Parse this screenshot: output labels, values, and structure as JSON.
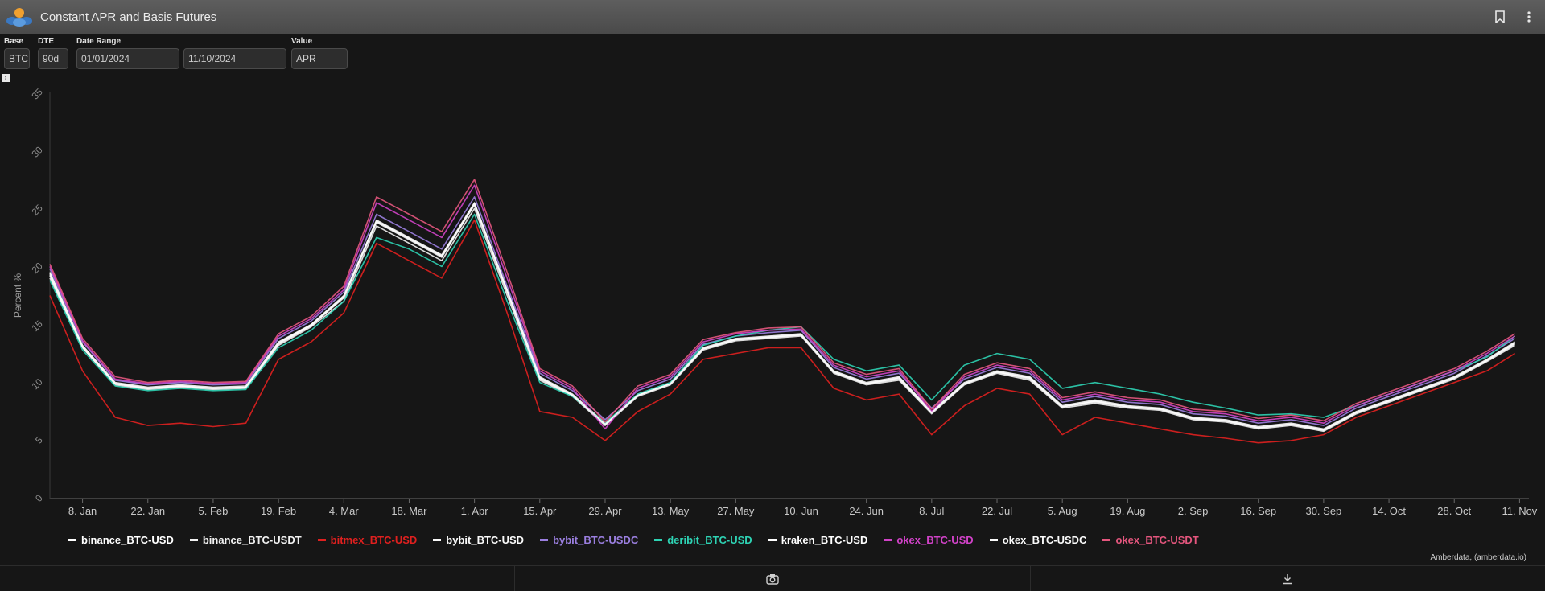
{
  "header": {
    "title": "Constant APR and Basis Futures"
  },
  "icons": {
    "logo": "amberdata-logo-icon",
    "bookmark": "bookmark-icon",
    "menu": "more-vertical-icon",
    "camera": "camera-icon",
    "download": "download-icon"
  },
  "controls": {
    "base": {
      "label": "Base",
      "value": "BTC"
    },
    "dte": {
      "label": "DTE",
      "value": "90d"
    },
    "date_range": {
      "label": "Date Range",
      "start": "01/01/2024",
      "end": "11/10/2024"
    },
    "value": {
      "label": "Value",
      "value": "APR"
    }
  },
  "credit": "Amberdata, (amberdata.io)",
  "chart_data": {
    "type": "line",
    "title": "",
    "xlabel": "",
    "ylabel": "Percent %",
    "ylim": [
      0,
      35
    ],
    "yticks": [
      0,
      5,
      10,
      15,
      20,
      25,
      30,
      35
    ],
    "x_ticks": [
      "8. Jan",
      "22. Jan",
      "5. Feb",
      "19. Feb",
      "4. Mar",
      "18. Mar",
      "1. Apr",
      "15. Apr",
      "29. Apr",
      "13. May",
      "27. May",
      "10. Jun",
      "24. Jun",
      "8. Jul",
      "22. Jul",
      "5. Aug",
      "19. Aug",
      "2. Sep",
      "16. Sep",
      "30. Sep",
      "14. Oct",
      "28. Oct",
      "11. Nov"
    ],
    "x": [
      "2024-01-01",
      "2024-01-08",
      "2024-01-15",
      "2024-01-22",
      "2024-01-29",
      "2024-02-05",
      "2024-02-12",
      "2024-02-19",
      "2024-02-26",
      "2024-03-04",
      "2024-03-11",
      "2024-03-18",
      "2024-03-25",
      "2024-04-01",
      "2024-04-08",
      "2024-04-15",
      "2024-04-22",
      "2024-04-29",
      "2024-05-06",
      "2024-05-13",
      "2024-05-20",
      "2024-05-27",
      "2024-06-03",
      "2024-06-10",
      "2024-06-17",
      "2024-06-24",
      "2024-07-01",
      "2024-07-08",
      "2024-07-15",
      "2024-07-22",
      "2024-07-29",
      "2024-08-05",
      "2024-08-12",
      "2024-08-19",
      "2024-08-26",
      "2024-09-02",
      "2024-09-09",
      "2024-09-16",
      "2024-09-23",
      "2024-09-30",
      "2024-10-07",
      "2024-10-14",
      "2024-10-21",
      "2024-10-28",
      "2024-11-04",
      "2024-11-10"
    ],
    "grid": false,
    "legend_position": "bottom",
    "series": [
      {
        "name": "binance_BTC-USD",
        "color": "#ffffff",
        "values": [
          19.5,
          13.2,
          10.0,
          9.6,
          9.8,
          9.6,
          9.7,
          13.5,
          15.0,
          17.5,
          24.0,
          22.5,
          21.0,
          25.5,
          18.0,
          10.5,
          9.0,
          6.5,
          9.0,
          10.0,
          13.0,
          13.8,
          14.0,
          14.2,
          11.0,
          10.0,
          10.5,
          7.5,
          10.0,
          11.0,
          10.5,
          8.0,
          8.5,
          8.0,
          7.8,
          7.0,
          6.8,
          6.2,
          6.5,
          6.0,
          7.5,
          8.5,
          9.5,
          10.5,
          12.0,
          13.5
        ]
      },
      {
        "name": "binance_BTC-USDT",
        "color": "#f2f2f2",
        "values": [
          19.0,
          13.0,
          9.8,
          9.4,
          9.6,
          9.4,
          9.5,
          13.2,
          14.8,
          17.0,
          23.5,
          22.0,
          20.5,
          25.0,
          17.5,
          10.2,
          8.8,
          6.3,
          8.8,
          9.8,
          12.8,
          13.6,
          13.8,
          14.0,
          10.8,
          9.8,
          10.2,
          7.3,
          9.8,
          10.8,
          10.2,
          7.8,
          8.2,
          7.8,
          7.6,
          6.8,
          6.6,
          6.0,
          6.3,
          5.8,
          7.3,
          8.3,
          9.3,
          10.3,
          11.8,
          13.2
        ]
      },
      {
        "name": "bitmex_BTC-USD",
        "color": "#e0201f",
        "values": [
          17.5,
          11.0,
          7.0,
          6.3,
          6.5,
          6.2,
          6.5,
          12.0,
          13.5,
          16.0,
          22.0,
          20.5,
          19.0,
          24.0,
          16.0,
          7.5,
          7.0,
          5.0,
          7.5,
          9.0,
          12.0,
          12.5,
          13.0,
          13.0,
          9.5,
          8.5,
          9.0,
          5.5,
          8.0,
          9.5,
          9.0,
          5.5,
          7.0,
          6.5,
          6.0,
          5.5,
          5.2,
          4.8,
          5.0,
          5.5,
          7.0,
          8.0,
          9.0,
          10.0,
          11.0,
          12.5
        ]
      },
      {
        "name": "bybit_BTC-USD",
        "color": "#fafafa",
        "values": [
          19.2,
          13.0,
          9.9,
          9.5,
          9.7,
          9.5,
          9.6,
          13.3,
          14.9,
          17.3,
          23.8,
          22.3,
          20.8,
          25.3,
          17.8,
          10.3,
          8.9,
          6.4,
          8.9,
          9.9,
          12.9,
          13.7,
          13.9,
          14.1,
          10.9,
          9.9,
          10.3,
          7.4,
          9.9,
          10.9,
          10.3,
          7.9,
          8.3,
          7.9,
          7.7,
          6.9,
          6.7,
          6.1,
          6.4,
          5.9,
          7.4,
          8.4,
          9.4,
          10.4,
          11.9,
          13.3
        ]
      },
      {
        "name": "bybit_BTC-USDC",
        "color": "#9b7fe0",
        "values": [
          19.8,
          13.5,
          10.2,
          9.8,
          10.0,
          9.8,
          9.9,
          13.8,
          15.3,
          17.8,
          24.5,
          23.0,
          21.5,
          26.0,
          18.3,
          10.8,
          9.3,
          6.8,
          9.3,
          10.3,
          13.3,
          14.0,
          14.3,
          14.5,
          11.3,
          10.3,
          10.8,
          7.8,
          10.3,
          11.3,
          10.8,
          8.3,
          8.8,
          8.3,
          8.1,
          7.3,
          7.1,
          6.5,
          6.8,
          6.3,
          7.8,
          8.8,
          9.8,
          10.8,
          12.3,
          13.8
        ]
      },
      {
        "name": "deribit_BTC-USD",
        "color": "#2ed3b4",
        "values": [
          18.8,
          12.8,
          9.7,
          9.3,
          9.5,
          9.3,
          9.4,
          13.0,
          14.5,
          17.0,
          22.5,
          21.5,
          20.0,
          24.5,
          17.0,
          10.0,
          8.8,
          6.5,
          9.0,
          10.0,
          13.2,
          14.0,
          14.5,
          14.8,
          12.0,
          11.0,
          11.5,
          8.5,
          11.5,
          12.5,
          12.0,
          9.5,
          10.0,
          9.5,
          9.0,
          8.3,
          7.8,
          7.2,
          7.3,
          7.0,
          8.0,
          9.0,
          10.0,
          11.0,
          12.2,
          14.0
        ]
      },
      {
        "name": "kraken_BTC-USD",
        "color": "#ffffff",
        "values": [
          19.3,
          13.1,
          9.9,
          9.5,
          9.7,
          9.5,
          9.6,
          13.4,
          14.9,
          17.4,
          23.9,
          22.4,
          20.9,
          25.4,
          17.9,
          10.4,
          8.9,
          6.4,
          8.9,
          9.9,
          12.9,
          13.7,
          13.9,
          14.1,
          10.9,
          9.9,
          10.4,
          7.4,
          9.9,
          10.9,
          10.4,
          7.9,
          8.4,
          7.9,
          7.7,
          6.9,
          6.7,
          6.1,
          6.4,
          5.9,
          7.4,
          8.4,
          9.4,
          10.4,
          11.9,
          13.4
        ]
      },
      {
        "name": "okex_BTC-USD",
        "color": "#d142c8",
        "values": [
          20.0,
          13.6,
          10.3,
          9.9,
          10.1,
          9.9,
          10.0,
          14.0,
          15.5,
          18.0,
          25.5,
          24.0,
          22.5,
          27.0,
          19.0,
          11.0,
          9.5,
          6.0,
          9.5,
          10.5,
          13.5,
          14.2,
          14.5,
          14.6,
          11.5,
          10.5,
          11.0,
          7.5,
          10.5,
          11.5,
          11.0,
          8.5,
          9.0,
          8.5,
          8.3,
          7.5,
          7.3,
          6.7,
          7.0,
          6.5,
          8.0,
          9.0,
          10.0,
          11.0,
          12.5,
          14.0
        ]
      },
      {
        "name": "okex_BTC-USDC",
        "color": "#fbfbfb",
        "values": [
          19.4,
          13.1,
          9.9,
          9.5,
          9.7,
          9.5,
          9.6,
          13.4,
          15.0,
          17.4,
          23.9,
          22.4,
          20.9,
          25.4,
          17.9,
          10.4,
          8.9,
          6.4,
          8.9,
          9.9,
          12.9,
          13.7,
          13.9,
          14.1,
          10.9,
          9.9,
          10.4,
          7.4,
          9.9,
          10.9,
          10.4,
          7.9,
          8.4,
          7.9,
          7.7,
          6.9,
          6.7,
          6.1,
          6.4,
          5.9,
          7.4,
          8.4,
          9.4,
          10.4,
          11.9,
          13.4
        ]
      },
      {
        "name": "okex_BTC-USDT",
        "color": "#e5567e",
        "values": [
          20.2,
          13.8,
          10.5,
          10.0,
          10.2,
          10.0,
          10.1,
          14.2,
          15.7,
          18.3,
          26.0,
          24.5,
          23.0,
          27.5,
          19.5,
          11.2,
          9.7,
          6.6,
          9.7,
          10.7,
          13.7,
          14.3,
          14.7,
          14.8,
          11.7,
          10.7,
          11.2,
          7.7,
          10.7,
          11.7,
          11.2,
          8.7,
          9.2,
          8.7,
          8.5,
          7.7,
          7.5,
          6.9,
          7.2,
          6.7,
          8.2,
          9.2,
          10.2,
          11.2,
          12.7,
          14.2
        ]
      }
    ]
  }
}
